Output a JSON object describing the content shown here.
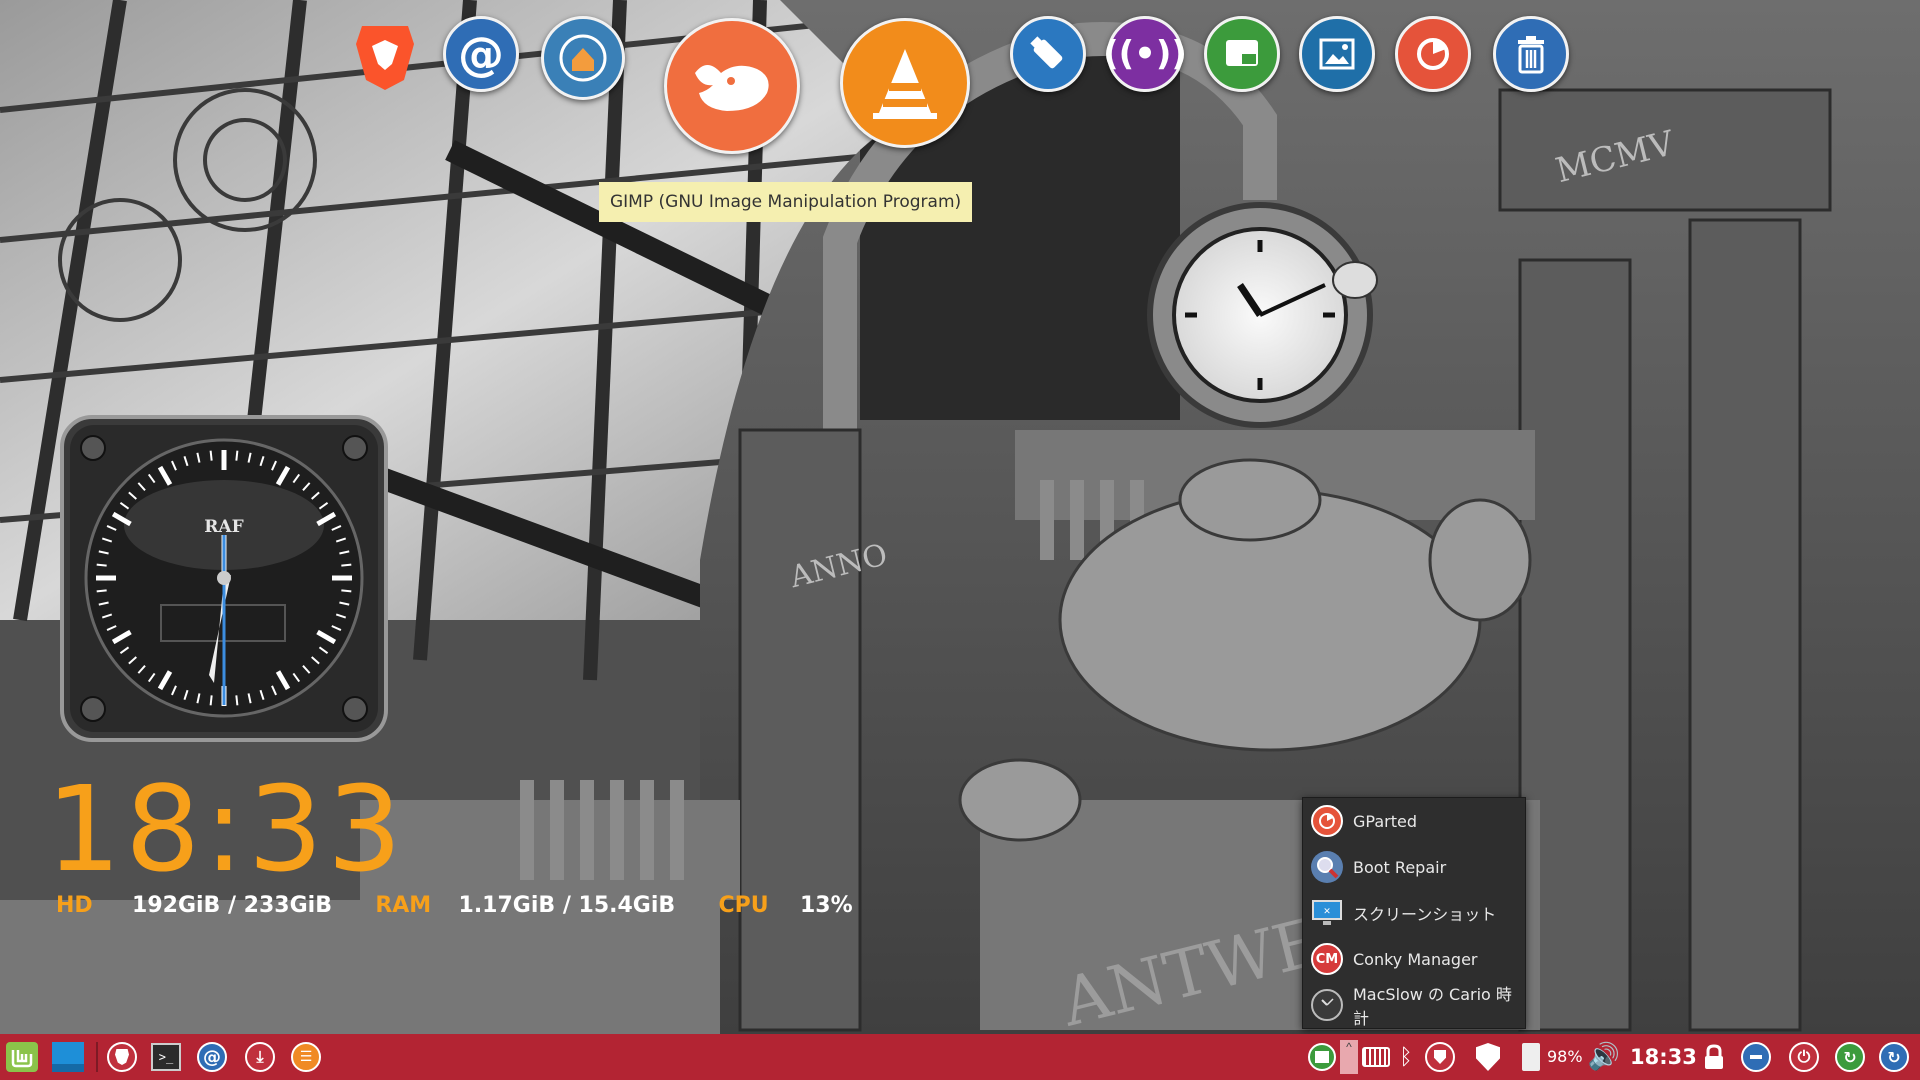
{
  "dock": {
    "items": [
      {
        "name": "Brave"
      },
      {
        "name": "Thunderbird Mail"
      },
      {
        "name": "Home"
      },
      {
        "name": "GIMP"
      },
      {
        "name": "VLC"
      },
      {
        "name": "USB Image Writer"
      },
      {
        "name": "Wireless"
      },
      {
        "name": "Workspace"
      },
      {
        "name": "Image Viewer"
      },
      {
        "name": "Disk Usage"
      },
      {
        "name": "Trash"
      }
    ],
    "tooltip": "GIMP (GNU Image Manipulation Program)"
  },
  "clock_widget": {
    "brand": "RAF"
  },
  "conky": {
    "time": "18:33",
    "hd_label": "HD",
    "hd_value": "192GiB / 233GiB",
    "ram_label": "RAM",
    "ram_value": "1.17GiB / 15.4GiB",
    "cpu_label": "CPU",
    "cpu_value": "13%"
  },
  "tray_menu": {
    "items": [
      {
        "label": "GParted",
        "icon": "gparted-icon"
      },
      {
        "label": "Boot Repair",
        "icon": "boot-repair-icon"
      },
      {
        "label": "スクリーンショット",
        "icon": "screenshot-icon"
      },
      {
        "label": "Conky Manager",
        "icon": "conky-manager-icon"
      },
      {
        "label": "MacSlow の Cario 時計",
        "icon": "clock-icon"
      }
    ]
  },
  "taskbar": {
    "battery": "98%",
    "clock": "18:33"
  },
  "wallpaper_text": {
    "roman": "MCMV",
    "anno": "ANNO",
    "antwerpen": "ANTWEF"
  },
  "colors": {
    "taskbar": "#b32433",
    "conky_accent": "#f7a01a",
    "tooltip": "#f5efb0"
  }
}
